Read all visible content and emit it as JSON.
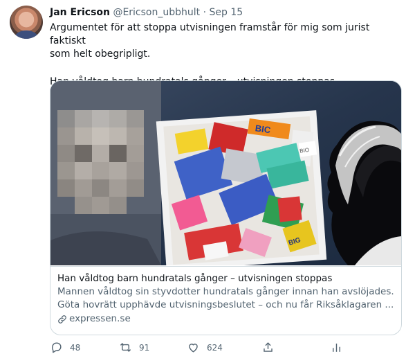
{
  "author": {
    "name": "Jan Ericson",
    "handle": "@Ericson_ubbhult",
    "separator": "·",
    "date": "Sep 15"
  },
  "tweet": {
    "paragraph1_line1": "Argumentet för att stoppa utvisningen framstår för mig som jurist faktiskt",
    "paragraph1_line2": "som helt obegripligt.",
    "paragraph2": "Han våldtog barn hundratals gånger – utvisningen stoppas"
  },
  "card": {
    "title": "Han våldtog barn hundratals gånger – utvisningen stoppas",
    "description_line1": "Mannen våldtog sin styvdotter hundratals gånger innan han avslöjades.",
    "description_line2": "Göta hovrätt upphävde utvisningsbeslutet – och nu får Riksåklagaren ...",
    "domain": "expressen.se",
    "pack_labels": [
      "BIC",
      "BIG",
      "BIO"
    ]
  },
  "actions": {
    "reply_count": "48",
    "retweet_count": "91",
    "like_count": "624"
  },
  "icons": {
    "reply": "reply-icon",
    "retweet": "retweet-icon",
    "like": "heart-icon",
    "share": "share-icon",
    "analytics": "analytics-icon",
    "link": "link-icon"
  }
}
